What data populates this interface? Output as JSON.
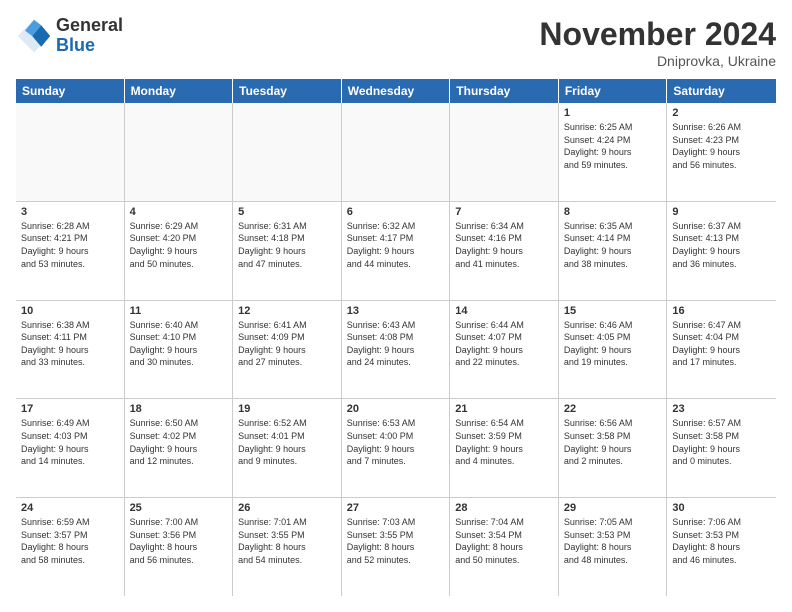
{
  "header": {
    "title": "November 2024",
    "location": "Dniprovka, Ukraine",
    "logo_general": "General",
    "logo_blue": "Blue"
  },
  "days_of_week": [
    "Sunday",
    "Monday",
    "Tuesday",
    "Wednesday",
    "Thursday",
    "Friday",
    "Saturday"
  ],
  "weeks": [
    {
      "days": [
        {
          "num": "",
          "info": "",
          "empty": true
        },
        {
          "num": "",
          "info": "",
          "empty": true
        },
        {
          "num": "",
          "info": "",
          "empty": true
        },
        {
          "num": "",
          "info": "",
          "empty": true
        },
        {
          "num": "",
          "info": "",
          "empty": true
        },
        {
          "num": "1",
          "info": "Sunrise: 6:25 AM\nSunset: 4:24 PM\nDaylight: 9 hours\nand 59 minutes.",
          "empty": false
        },
        {
          "num": "2",
          "info": "Sunrise: 6:26 AM\nSunset: 4:23 PM\nDaylight: 9 hours\nand 56 minutes.",
          "empty": false
        }
      ]
    },
    {
      "days": [
        {
          "num": "3",
          "info": "Sunrise: 6:28 AM\nSunset: 4:21 PM\nDaylight: 9 hours\nand 53 minutes.",
          "empty": false
        },
        {
          "num": "4",
          "info": "Sunrise: 6:29 AM\nSunset: 4:20 PM\nDaylight: 9 hours\nand 50 minutes.",
          "empty": false
        },
        {
          "num": "5",
          "info": "Sunrise: 6:31 AM\nSunset: 4:18 PM\nDaylight: 9 hours\nand 47 minutes.",
          "empty": false
        },
        {
          "num": "6",
          "info": "Sunrise: 6:32 AM\nSunset: 4:17 PM\nDaylight: 9 hours\nand 44 minutes.",
          "empty": false
        },
        {
          "num": "7",
          "info": "Sunrise: 6:34 AM\nSunset: 4:16 PM\nDaylight: 9 hours\nand 41 minutes.",
          "empty": false
        },
        {
          "num": "8",
          "info": "Sunrise: 6:35 AM\nSunset: 4:14 PM\nDaylight: 9 hours\nand 38 minutes.",
          "empty": false
        },
        {
          "num": "9",
          "info": "Sunrise: 6:37 AM\nSunset: 4:13 PM\nDaylight: 9 hours\nand 36 minutes.",
          "empty": false
        }
      ]
    },
    {
      "days": [
        {
          "num": "10",
          "info": "Sunrise: 6:38 AM\nSunset: 4:11 PM\nDaylight: 9 hours\nand 33 minutes.",
          "empty": false
        },
        {
          "num": "11",
          "info": "Sunrise: 6:40 AM\nSunset: 4:10 PM\nDaylight: 9 hours\nand 30 minutes.",
          "empty": false
        },
        {
          "num": "12",
          "info": "Sunrise: 6:41 AM\nSunset: 4:09 PM\nDaylight: 9 hours\nand 27 minutes.",
          "empty": false
        },
        {
          "num": "13",
          "info": "Sunrise: 6:43 AM\nSunset: 4:08 PM\nDaylight: 9 hours\nand 24 minutes.",
          "empty": false
        },
        {
          "num": "14",
          "info": "Sunrise: 6:44 AM\nSunset: 4:07 PM\nDaylight: 9 hours\nand 22 minutes.",
          "empty": false
        },
        {
          "num": "15",
          "info": "Sunrise: 6:46 AM\nSunset: 4:05 PM\nDaylight: 9 hours\nand 19 minutes.",
          "empty": false
        },
        {
          "num": "16",
          "info": "Sunrise: 6:47 AM\nSunset: 4:04 PM\nDaylight: 9 hours\nand 17 minutes.",
          "empty": false
        }
      ]
    },
    {
      "days": [
        {
          "num": "17",
          "info": "Sunrise: 6:49 AM\nSunset: 4:03 PM\nDaylight: 9 hours\nand 14 minutes.",
          "empty": false
        },
        {
          "num": "18",
          "info": "Sunrise: 6:50 AM\nSunset: 4:02 PM\nDaylight: 9 hours\nand 12 minutes.",
          "empty": false
        },
        {
          "num": "19",
          "info": "Sunrise: 6:52 AM\nSunset: 4:01 PM\nDaylight: 9 hours\nand 9 minutes.",
          "empty": false
        },
        {
          "num": "20",
          "info": "Sunrise: 6:53 AM\nSunset: 4:00 PM\nDaylight: 9 hours\nand 7 minutes.",
          "empty": false
        },
        {
          "num": "21",
          "info": "Sunrise: 6:54 AM\nSunset: 3:59 PM\nDaylight: 9 hours\nand 4 minutes.",
          "empty": false
        },
        {
          "num": "22",
          "info": "Sunrise: 6:56 AM\nSunset: 3:58 PM\nDaylight: 9 hours\nand 2 minutes.",
          "empty": false
        },
        {
          "num": "23",
          "info": "Sunrise: 6:57 AM\nSunset: 3:58 PM\nDaylight: 9 hours\nand 0 minutes.",
          "empty": false
        }
      ]
    },
    {
      "days": [
        {
          "num": "24",
          "info": "Sunrise: 6:59 AM\nSunset: 3:57 PM\nDaylight: 8 hours\nand 58 minutes.",
          "empty": false
        },
        {
          "num": "25",
          "info": "Sunrise: 7:00 AM\nSunset: 3:56 PM\nDaylight: 8 hours\nand 56 minutes.",
          "empty": false
        },
        {
          "num": "26",
          "info": "Sunrise: 7:01 AM\nSunset: 3:55 PM\nDaylight: 8 hours\nand 54 minutes.",
          "empty": false
        },
        {
          "num": "27",
          "info": "Sunrise: 7:03 AM\nSunset: 3:55 PM\nDaylight: 8 hours\nand 52 minutes.",
          "empty": false
        },
        {
          "num": "28",
          "info": "Sunrise: 7:04 AM\nSunset: 3:54 PM\nDaylight: 8 hours\nand 50 minutes.",
          "empty": false
        },
        {
          "num": "29",
          "info": "Sunrise: 7:05 AM\nSunset: 3:53 PM\nDaylight: 8 hours\nand 48 minutes.",
          "empty": false
        },
        {
          "num": "30",
          "info": "Sunrise: 7:06 AM\nSunset: 3:53 PM\nDaylight: 8 hours\nand 46 minutes.",
          "empty": false
        }
      ]
    }
  ]
}
